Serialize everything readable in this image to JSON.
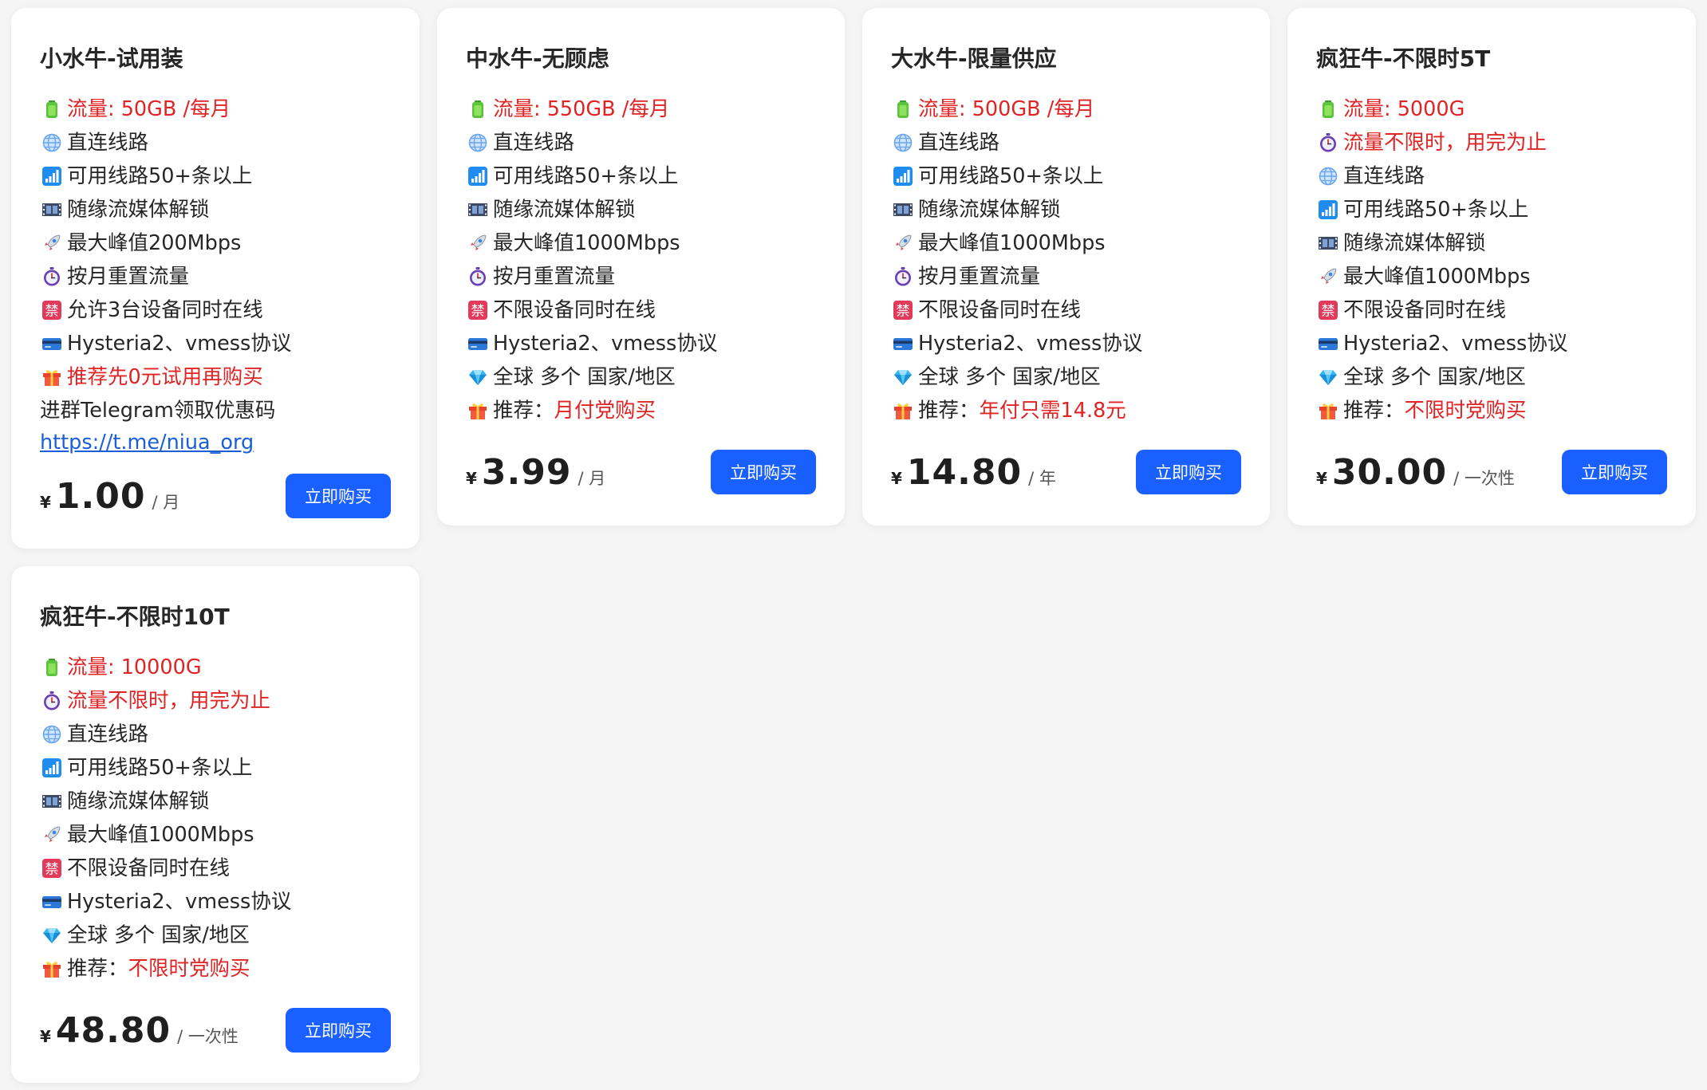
{
  "plans": [
    {
      "title": "小水牛-试用装",
      "features": [
        {
          "icon": "battery-icon",
          "text": "流量: 50GB /每月",
          "red": true
        },
        {
          "icon": "globe-icon",
          "text": "直连线路"
        },
        {
          "icon": "signal-bars-icon",
          "text": "可用线路50+条以上"
        },
        {
          "icon": "film-icon",
          "text": "随缘流媒体解锁"
        },
        {
          "icon": "rocket-icon",
          "text": "最大峰值200Mbps"
        },
        {
          "icon": "stopwatch-icon",
          "text": "按月重置流量"
        },
        {
          "icon": "prohibited-sign-icon",
          "text": "允许3台设备同时在线"
        },
        {
          "icon": "credit-card-icon",
          "text": "Hysteria2、vmess协议"
        },
        {
          "icon": "gift-icon",
          "text": "推荐先0元试用再购买",
          "red": true
        }
      ],
      "note": "进群Telegram领取优惠码",
      "link": "https://t.me/niua_org",
      "currency": "¥",
      "price": "1.00",
      "period": "/ 月",
      "button": "立即购买"
    },
    {
      "title": "中水牛-无顾虑",
      "features": [
        {
          "icon": "battery-icon",
          "text": "流量: 550GB /每月",
          "red": true
        },
        {
          "icon": "globe-icon",
          "text": "直连线路"
        },
        {
          "icon": "signal-bars-icon",
          "text": "可用线路50+条以上"
        },
        {
          "icon": "film-icon",
          "text": "随缘流媒体解锁"
        },
        {
          "icon": "rocket-icon",
          "text": "最大峰值1000Mbps"
        },
        {
          "icon": "stopwatch-icon",
          "text": "按月重置流量"
        },
        {
          "icon": "prohibited-sign-icon",
          "text": "不限设备同时在线"
        },
        {
          "icon": "credit-card-icon",
          "text": "Hysteria2、vmess协议"
        },
        {
          "icon": "gem-icon",
          "text": "全球 多个 国家/地区"
        },
        {
          "icon": "gift-icon",
          "text": "推荐：",
          "highlight": "月付党购买"
        }
      ],
      "currency": "¥",
      "price": "3.99",
      "period": "/ 月",
      "button": "立即购买"
    },
    {
      "title": "大水牛-限量供应",
      "features": [
        {
          "icon": "battery-icon",
          "text": "流量: 500GB /每月",
          "red": true
        },
        {
          "icon": "globe-icon",
          "text": "直连线路"
        },
        {
          "icon": "signal-bars-icon",
          "text": "可用线路50+条以上"
        },
        {
          "icon": "film-icon",
          "text": "随缘流媒体解锁"
        },
        {
          "icon": "rocket-icon",
          "text": "最大峰值1000Mbps"
        },
        {
          "icon": "stopwatch-icon",
          "text": "按月重置流量"
        },
        {
          "icon": "prohibited-sign-icon",
          "text": "不限设备同时在线"
        },
        {
          "icon": "credit-card-icon",
          "text": "Hysteria2、vmess协议"
        },
        {
          "icon": "gem-icon",
          "text": "全球 多个 国家/地区"
        },
        {
          "icon": "gift-icon",
          "text": "推荐：",
          "highlight": "年付只需14.8元"
        }
      ],
      "currency": "¥",
      "price": "14.80",
      "period": "/ 年",
      "button": "立即购买"
    },
    {
      "title": "疯狂牛-不限时5T",
      "features": [
        {
          "icon": "battery-icon",
          "text": "流量: 5000G",
          "red": true
        },
        {
          "icon": "stopwatch-icon",
          "text": "流量不限时，用完为止",
          "red": true
        },
        {
          "icon": "globe-icon",
          "text": "直连线路"
        },
        {
          "icon": "signal-bars-icon",
          "text": "可用线路50+条以上"
        },
        {
          "icon": "film-icon",
          "text": "随缘流媒体解锁"
        },
        {
          "icon": "rocket-icon",
          "text": "最大峰值1000Mbps"
        },
        {
          "icon": "prohibited-sign-icon",
          "text": "不限设备同时在线"
        },
        {
          "icon": "credit-card-icon",
          "text": "Hysteria2、vmess协议"
        },
        {
          "icon": "gem-icon",
          "text": "全球 多个 国家/地区"
        },
        {
          "icon": "gift-icon",
          "text": "推荐：",
          "highlight": "不限时党购买"
        }
      ],
      "currency": "¥",
      "price": "30.00",
      "period": "/ 一次性",
      "button": "立即购买"
    },
    {
      "title": "疯狂牛-不限时10T",
      "features": [
        {
          "icon": "battery-icon",
          "text": "流量: 10000G",
          "red": true
        },
        {
          "icon": "stopwatch-icon",
          "text": "流量不限时，用完为止",
          "red": true
        },
        {
          "icon": "globe-icon",
          "text": "直连线路"
        },
        {
          "icon": "signal-bars-icon",
          "text": "可用线路50+条以上"
        },
        {
          "icon": "film-icon",
          "text": "随缘流媒体解锁"
        },
        {
          "icon": "rocket-icon",
          "text": "最大峰值1000Mbps"
        },
        {
          "icon": "prohibited-sign-icon",
          "text": "不限设备同时在线"
        },
        {
          "icon": "credit-card-icon",
          "text": "Hysteria2、vmess协议"
        },
        {
          "icon": "gem-icon",
          "text": "全球 多个 国家/地区"
        },
        {
          "icon": "gift-icon",
          "text": "推荐：",
          "highlight": "不限时党购买"
        }
      ],
      "currency": "¥",
      "price": "48.80",
      "period": "/ 一次性",
      "button": "立即购买"
    }
  ],
  "colors": {
    "accent": "#1a5fff",
    "highlight": "#e02424",
    "link": "#1a5fd6",
    "background": "#f5f5f6",
    "card": "#ffffff"
  }
}
